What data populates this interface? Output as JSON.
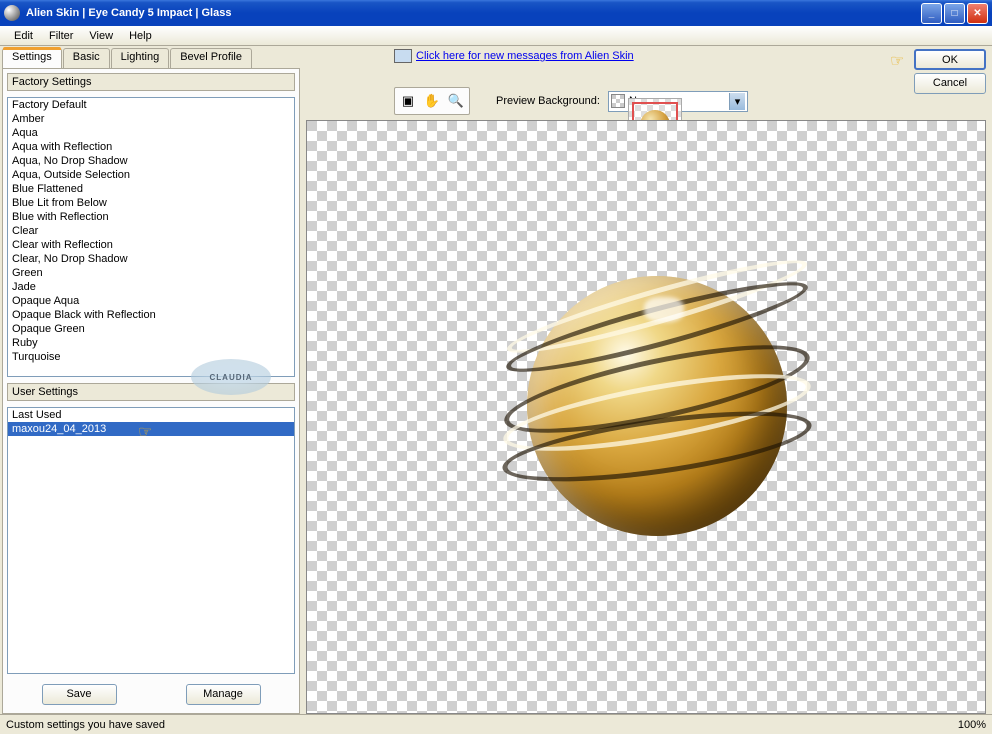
{
  "window": {
    "title": "Alien Skin  |  Eye Candy 5 Impact  |  Glass"
  },
  "menu": {
    "edit": "Edit",
    "filter": "Filter",
    "view": "View",
    "help": "Help"
  },
  "tabs": {
    "settings": "Settings",
    "basic": "Basic",
    "lighting": "Lighting",
    "bevel": "Bevel Profile"
  },
  "factory": {
    "header": "Factory Settings",
    "items": [
      "Factory Default",
      "Amber",
      "Aqua",
      "Aqua with Reflection",
      "Aqua, No Drop Shadow",
      "Aqua, Outside Selection",
      "Blue Flattened",
      "Blue Lit from Below",
      "Blue with Reflection",
      "Clear",
      "Clear with Reflection",
      "Clear, No Drop Shadow",
      "Green",
      "Jade",
      "Opaque Aqua",
      "Opaque Black with Reflection",
      "Opaque Green",
      "Ruby",
      "Turquoise"
    ]
  },
  "user": {
    "header": "User Settings",
    "items": [
      "Last Used",
      "maxou24_04_2013"
    ],
    "selected_index": 1
  },
  "buttons": {
    "save": "Save",
    "manage": "Manage",
    "ok": "OK",
    "cancel": "Cancel"
  },
  "link": {
    "text": "Click here for new messages from Alien Skin"
  },
  "preview": {
    "label": "Preview Background:",
    "selected": "None"
  },
  "watermark": "CLAUDIA",
  "status": {
    "text": "Custom settings you have saved",
    "zoom": "100%"
  }
}
